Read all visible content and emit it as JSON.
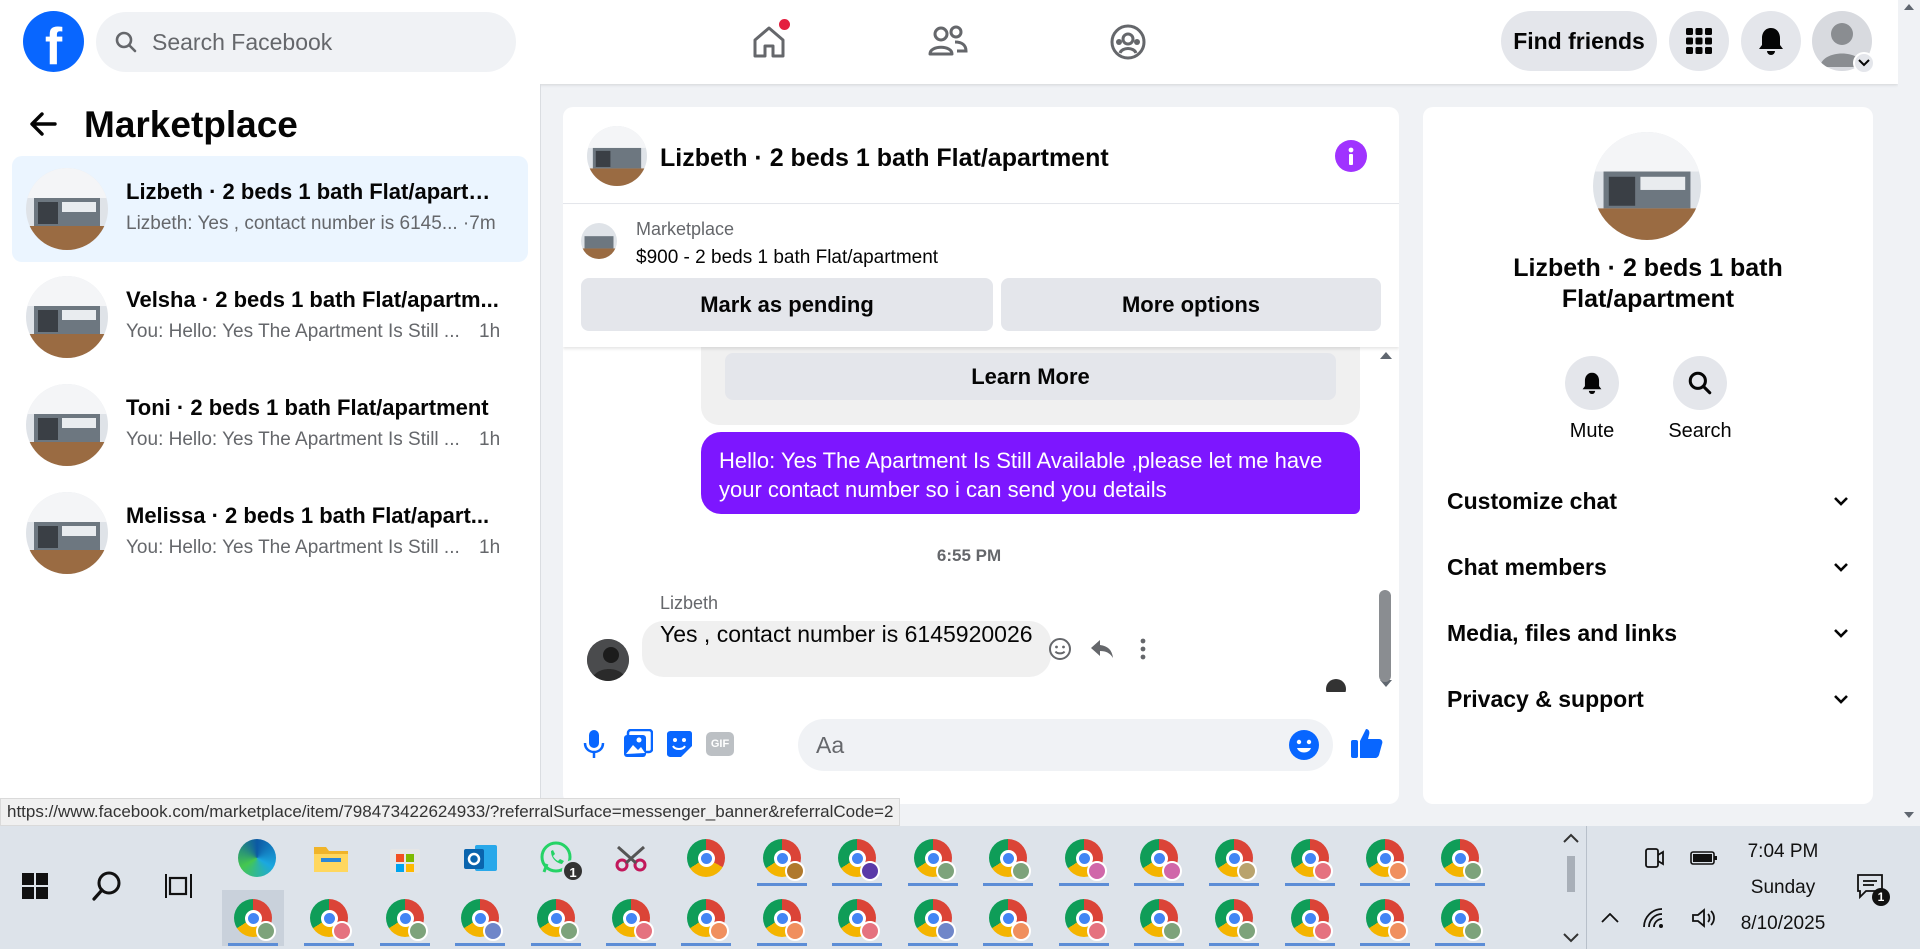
{
  "topbar": {
    "logo": "f",
    "search_placeholder": "Search Facebook",
    "find_friends": "Find friends"
  },
  "left": {
    "title": "Marketplace",
    "conversations": [
      {
        "title": "Lizbeth · 2 beds 1 bath Flat/apartm...",
        "preview": "Lizbeth: Yes , contact number is 6145... ·7m",
        "time": ""
      },
      {
        "title": "Velsha · 2 beds 1 bath Flat/apartm...",
        "preview": "You: Hello: Yes The Apartment Is Still ...",
        "time": "1h"
      },
      {
        "title": "Toni · 2 beds 1 bath Flat/apartment",
        "preview": "You: Hello: Yes The Apartment Is Still ...",
        "time": "1h"
      },
      {
        "title": "Melissa · 2 beds 1 bath Flat/apart...",
        "preview": "You: Hello: Yes The Apartment Is Still ...",
        "time": "1h"
      }
    ]
  },
  "chat": {
    "title": "Lizbeth · 2 beds 1 bath Flat/apartment",
    "listing": {
      "source": "Marketplace",
      "price_title": "$900 - 2 beds 1 bath Flat/apartment",
      "mark_pending": "Mark as pending",
      "more_options": "More options"
    },
    "learn_more": "Learn More",
    "outgoing": "Hello: Yes The Apartment Is Still Available ,please let me have your contact number so i can send you details",
    "timestamp": "6:55 PM",
    "sender": "Lizbeth",
    "incoming": "Yes , contact number is 6145920026",
    "composer_placeholder": "Aa",
    "gif_label": "GIF"
  },
  "right": {
    "title": "Lizbeth · 2 beds 1 bath Flat/apartment",
    "mute": "Mute",
    "search": "Search",
    "sections": [
      "Customize chat",
      "Chat members",
      "Media, files and links",
      "Privacy & support"
    ]
  },
  "status_url": "https://www.facebook.com/marketplace/item/798473422624933/?referralSurface=messenger_banner&referralCode=2",
  "taskbar": {
    "whatsapp_badge": "1",
    "time": "7:04 PM",
    "day": "Sunday",
    "date": "8/10/2025",
    "notif_badge": "1"
  },
  "colors": {
    "facebook_blue": "#0866ff",
    "messenger_purple": "#7d16ff",
    "notification_red": "#e41e3f"
  }
}
